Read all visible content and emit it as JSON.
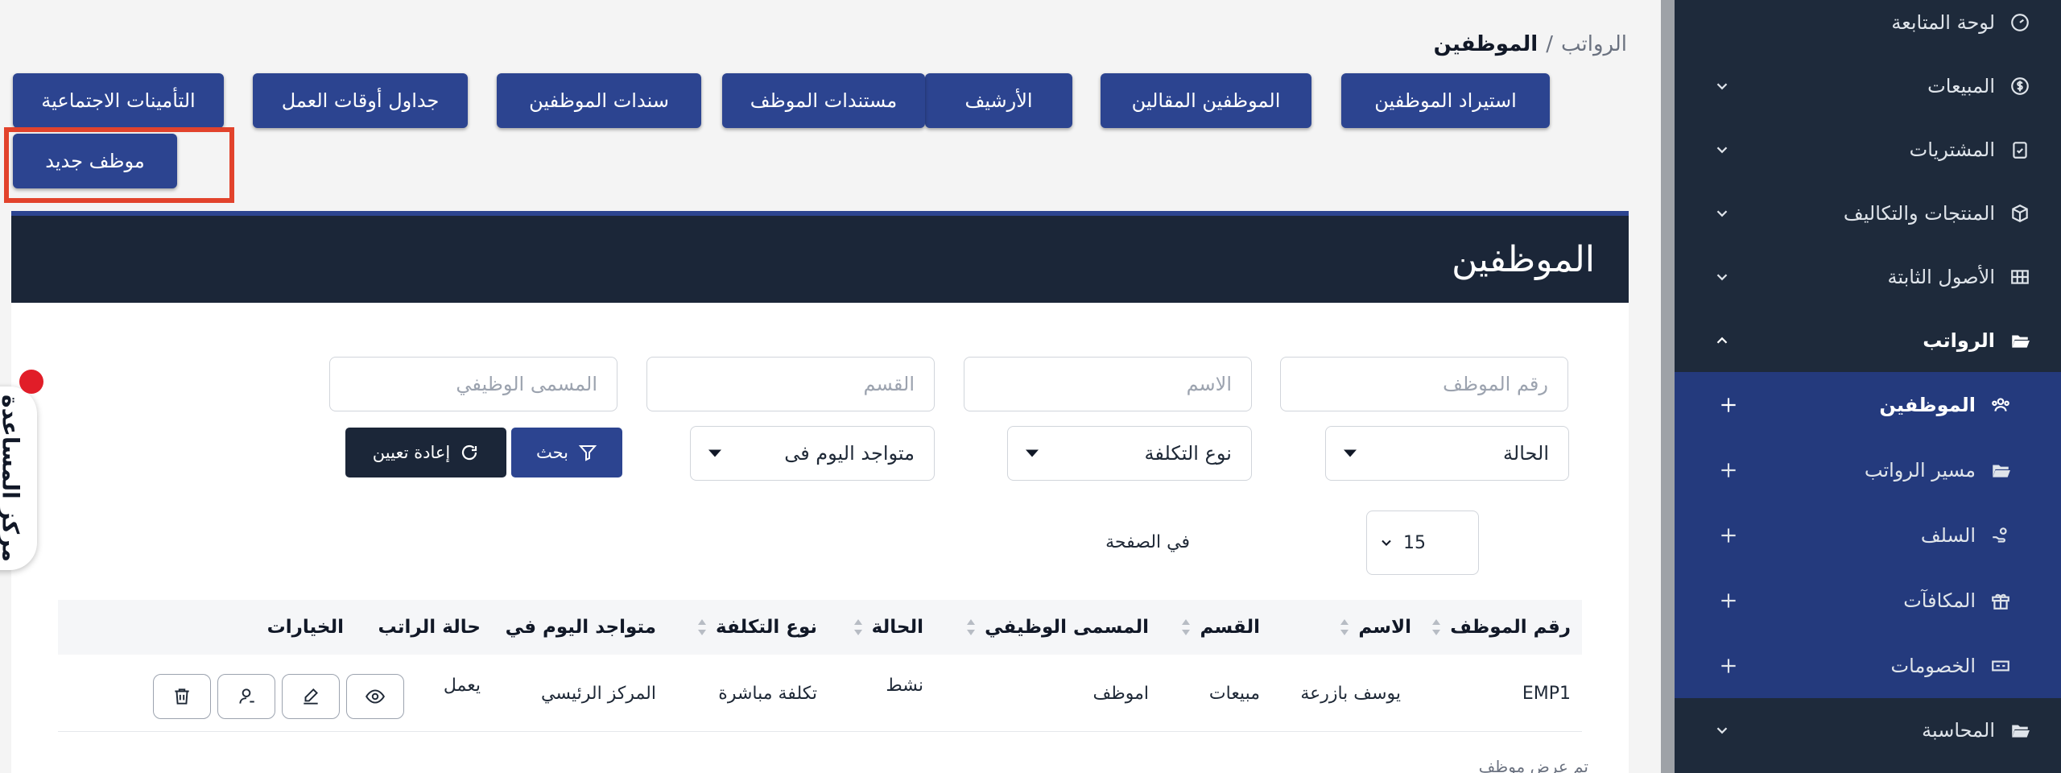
{
  "breadcrumb": {
    "parent": "الرواتب",
    "separator": "/",
    "current": "الموظفين"
  },
  "toolbar": {
    "row1": [
      {
        "label": "استيراد الموظفين",
        "name": "import-employees-button"
      },
      {
        "label": "الموظفين المقالين",
        "name": "dismissed-employees-button"
      },
      {
        "label": "الأرشيف",
        "name": "archive-button"
      },
      {
        "label": "مستندات الموظف",
        "name": "employee-documents-button"
      },
      {
        "label": "سندات الموظفين",
        "name": "employee-vouchers-button"
      },
      {
        "label": "جداول أوقات العمل",
        "name": "work-schedules-button"
      },
      {
        "label": "التأمينات الاجتماعية",
        "name": "social-insurance-button"
      }
    ],
    "new_employee": "موظف جديد"
  },
  "panel": {
    "title": "الموظفين"
  },
  "filters": {
    "employee_no_placeholder": "رقم الموظف",
    "name_placeholder": "الاسم",
    "department_placeholder": "القسم",
    "job_title_placeholder": "المسمى الوظيفي",
    "status_select": "الحالة",
    "cost_type_select": "نوع التكلفة",
    "present_today_select": "متواجد اليوم فى",
    "search_button": "بحث",
    "reset_button": "إعادة تعيين"
  },
  "pagination": {
    "per_page_label": "في الصفحة",
    "per_page_value": "15"
  },
  "table": {
    "headers": {
      "employee_no": "رقم الموظف",
      "name": "الاسم",
      "department": "القسم",
      "job_title": "المسمى الوظيفي",
      "status": "الحالة",
      "cost_type": "نوع التكلفة",
      "present_today": "متواجد اليوم في",
      "salary_status": "حالة الراتب",
      "options": "الخيارات"
    },
    "rows": [
      {
        "employee_no": "EMP1",
        "name": "يوسف بازرعة",
        "department": "مبيعات",
        "job_title": "اموظف",
        "status": "نشط",
        "cost_type": "تكلفة مباشرة",
        "present_today": "المركز الرئيسي",
        "salary_status": "يعمل"
      }
    ],
    "footer_note": "تم عرض موظف"
  },
  "help": {
    "label": "مركز المساعدة"
  },
  "sidebar": {
    "dashboard": "لوحة المتابعة",
    "sales": "المبيعات",
    "purchases": "المشتريات",
    "products_costs": "المنتجات والتكاليف",
    "fixed_assets": "الأصول الثابتة",
    "payroll": "الرواتب",
    "payroll_sub": {
      "employees": "الموظفين",
      "payroll_run": "مسير الرواتب",
      "advances": "السلف",
      "bonuses": "المكافآت",
      "deductions": "الخصومات"
    },
    "accounting": "المحاسبة"
  },
  "colors": {
    "primary": "#2c4490",
    "sidebar_bg": "#1e2a3b",
    "sidebar_sub_bg": "#243a7d",
    "panel_header_bg": "#1b2638",
    "highlight": "#e2432c",
    "reset_button_bg": "#1b2638"
  }
}
